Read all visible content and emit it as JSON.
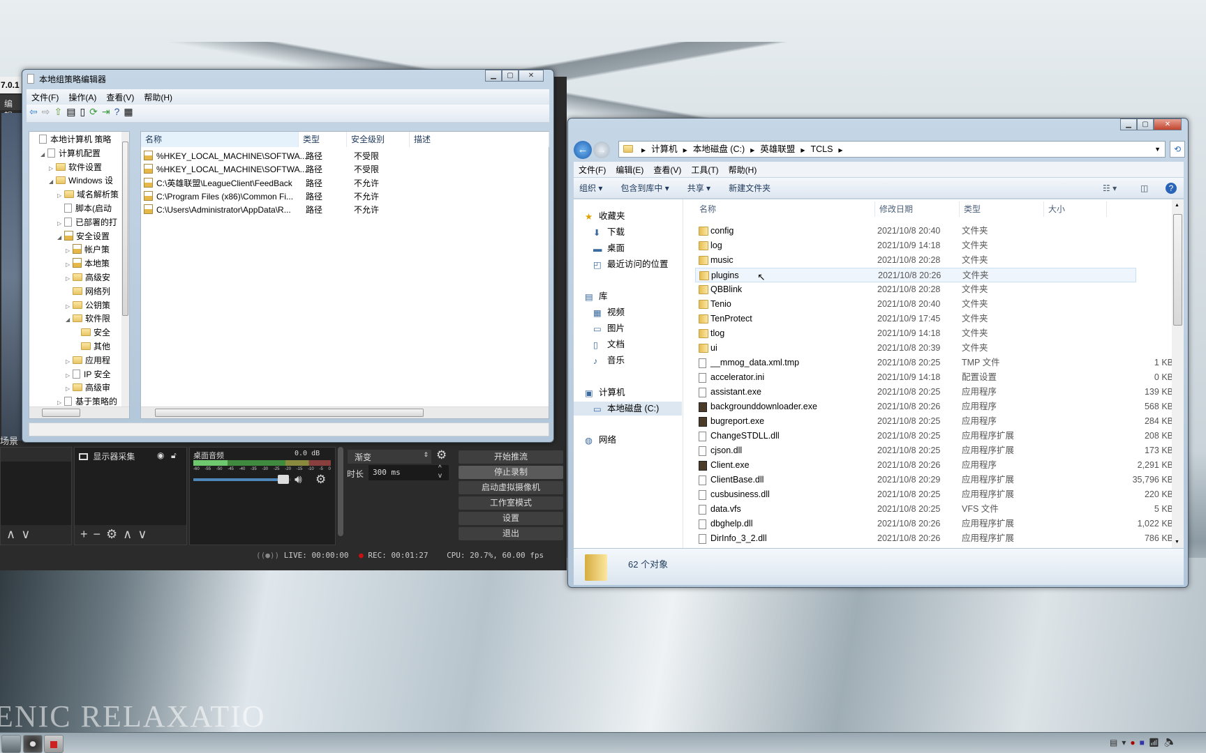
{
  "desktop": {
    "watermark": "ENIC RELAXATIO"
  },
  "obs": {
    "version_fragment": "7.0.1",
    "menu_fragment": "编辑",
    "scenes_label": "场景",
    "source_name": "显示器采集",
    "mixer": {
      "name": "桌面音频",
      "db": "0.0 dB",
      "scale": [
        "-60",
        "-55",
        "-50",
        "-45",
        "-40",
        "-35",
        "-30",
        "-25",
        "-20",
        "-15",
        "-10",
        "-5",
        "0"
      ],
      "volume": 0.95
    },
    "transition": {
      "type": "渐变",
      "duration_label": "时长",
      "duration": "300 ms"
    },
    "controls": [
      "开始推流",
      "停止录制",
      "启动虚拟摄像机",
      "工作室模式",
      "设置",
      "退出"
    ],
    "status": {
      "live": "LIVE: 00:00:00",
      "rec": "REC: 00:01:27",
      "cpu": "CPU: 20.7%, 60.00 fps"
    }
  },
  "gpedit": {
    "title": "本地组策略编辑器",
    "menu": [
      "文件(F)",
      "操作(A)",
      "查看(V)",
      "帮助(H)"
    ],
    "tree": [
      {
        "label": "本地计算机 策略",
        "level": 0,
        "icon": "policy"
      },
      {
        "label": "计算机配置",
        "level": 1,
        "icon": "computer",
        "exp": "open"
      },
      {
        "label": "软件设置",
        "level": 2,
        "icon": "folder",
        "exp": "closed"
      },
      {
        "label": "Windows 设",
        "level": 2,
        "icon": "folder",
        "exp": "open"
      },
      {
        "label": "域名解析策",
        "level": 3,
        "icon": "folder",
        "exp": "closed"
      },
      {
        "label": "脚本(启动",
        "level": 3,
        "icon": "script"
      },
      {
        "label": "已部署的打",
        "level": 3,
        "icon": "printer",
        "exp": "closed"
      },
      {
        "label": "安全设置",
        "level": 3,
        "icon": "security",
        "exp": "open"
      },
      {
        "label": "帐户策",
        "level": 4,
        "icon": "lock",
        "exp": "closed"
      },
      {
        "label": "本地策",
        "level": 4,
        "icon": "lock",
        "exp": "closed"
      },
      {
        "label": "高级安",
        "level": 4,
        "icon": "folder",
        "exp": "closed"
      },
      {
        "label": "网络列",
        "level": 4,
        "icon": "folder"
      },
      {
        "label": "公钥策",
        "level": 4,
        "icon": "folder",
        "exp": "closed"
      },
      {
        "label": "软件限",
        "level": 4,
        "icon": "folder",
        "exp": "open"
      },
      {
        "label": "安全",
        "level": 5,
        "icon": "folder"
      },
      {
        "label": "其他",
        "level": 5,
        "icon": "folder"
      },
      {
        "label": "应用程",
        "level": 4,
        "icon": "folder",
        "exp": "closed"
      },
      {
        "label": "IP 安全",
        "level": 4,
        "icon": "ipsec",
        "exp": "closed"
      },
      {
        "label": "高级审",
        "level": 4,
        "icon": "folder",
        "exp": "closed"
      },
      {
        "label": "基于策略的",
        "level": 3,
        "icon": "chart",
        "exp": "closed"
      }
    ],
    "columns": [
      "名称",
      "类型",
      "安全级别",
      "描述"
    ],
    "rows": [
      {
        "name": "%HKEY_LOCAL_MACHINE\\SOFTWA...",
        "type": "路径",
        "level": "不受限",
        "desc": ""
      },
      {
        "name": "%HKEY_LOCAL_MACHINE\\SOFTWA...",
        "type": "路径",
        "level": "不受限",
        "desc": ""
      },
      {
        "name": "C:\\英雄联盟\\LeagueClient\\FeedBack",
        "type": "路径",
        "level": "不允许",
        "desc": ""
      },
      {
        "name": "C:\\Program Files (x86)\\Common Fi...",
        "type": "路径",
        "level": "不允许",
        "desc": ""
      },
      {
        "name": "C:\\Users\\Administrator\\AppData\\R...",
        "type": "路径",
        "level": "不允许",
        "desc": ""
      }
    ]
  },
  "explorer": {
    "breadcrumb": [
      "计算机",
      "本地磁盘 (C:)",
      "英雄联盟",
      "TCLS"
    ],
    "menu": [
      "文件(F)",
      "编辑(E)",
      "查看(V)",
      "工具(T)",
      "帮助(H)"
    ],
    "commands": [
      "组织 ▾",
      "包含到库中 ▾",
      "共享 ▾",
      "新建文件夹"
    ],
    "nav": [
      {
        "label": "收藏夹",
        "level": 0,
        "icon": "star"
      },
      {
        "label": "下载",
        "level": 1,
        "icon": "download"
      },
      {
        "label": "桌面",
        "level": 1,
        "icon": "desktop"
      },
      {
        "label": "最近访问的位置",
        "level": 1,
        "icon": "recent"
      },
      {
        "label": "库",
        "level": 0,
        "icon": "library"
      },
      {
        "label": "视频",
        "level": 1,
        "icon": "video"
      },
      {
        "label": "图片",
        "level": 1,
        "icon": "picture"
      },
      {
        "label": "文档",
        "level": 1,
        "icon": "document"
      },
      {
        "label": "音乐",
        "level": 1,
        "icon": "music"
      },
      {
        "label": "计算机",
        "level": 0,
        "icon": "computer"
      },
      {
        "label": "本地磁盘 (C:)",
        "level": 1,
        "icon": "drive",
        "selected": true
      },
      {
        "label": "网络",
        "level": 0,
        "icon": "network"
      }
    ],
    "columns": [
      "名称",
      "修改日期",
      "类型",
      "大小"
    ],
    "hovered_row": "plugins",
    "files": [
      {
        "name": "config",
        "date": "2021/10/8 20:40",
        "type": "文件夹",
        "size": "",
        "icon": "folder"
      },
      {
        "name": "log",
        "date": "2021/10/9 14:18",
        "type": "文件夹",
        "size": "",
        "icon": "folder"
      },
      {
        "name": "music",
        "date": "2021/10/8 20:28",
        "type": "文件夹",
        "size": "",
        "icon": "folder"
      },
      {
        "name": "plugins",
        "date": "2021/10/8 20:26",
        "type": "文件夹",
        "size": "",
        "icon": "folder"
      },
      {
        "name": "QBBlink",
        "date": "2021/10/8 20:28",
        "type": "文件夹",
        "size": "",
        "icon": "folder"
      },
      {
        "name": "Tenio",
        "date": "2021/10/8 20:40",
        "type": "文件夹",
        "size": "",
        "icon": "folder"
      },
      {
        "name": "TenProtect",
        "date": "2021/10/9 17:45",
        "type": "文件夹",
        "size": "",
        "icon": "folder"
      },
      {
        "name": "tlog",
        "date": "2021/10/9 14:18",
        "type": "文件夹",
        "size": "",
        "icon": "folder"
      },
      {
        "name": "ui",
        "date": "2021/10/8 20:39",
        "type": "文件夹",
        "size": "",
        "icon": "folder"
      },
      {
        "name": "__mmog_data.xml.tmp",
        "date": "2021/10/8 20:25",
        "type": "TMP 文件",
        "size": "1 KB",
        "icon": "file"
      },
      {
        "name": "accelerator.ini",
        "date": "2021/10/9 14:18",
        "type": "配置设置",
        "size": "0 KB",
        "icon": "file"
      },
      {
        "name": "assistant.exe",
        "date": "2021/10/8 20:25",
        "type": "应用程序",
        "size": "139 KB",
        "icon": "app"
      },
      {
        "name": "backgrounddownloader.exe",
        "date": "2021/10/8 20:26",
        "type": "应用程序",
        "size": "568 KB",
        "icon": "exe"
      },
      {
        "name": "bugreport.exe",
        "date": "2021/10/8 20:25",
        "type": "应用程序",
        "size": "284 KB",
        "icon": "exe"
      },
      {
        "name": "ChangeSTDLL.dll",
        "date": "2021/10/8 20:25",
        "type": "应用程序扩展",
        "size": "208 KB",
        "icon": "file"
      },
      {
        "name": "cjson.dll",
        "date": "2021/10/8 20:25",
        "type": "应用程序扩展",
        "size": "173 KB",
        "icon": "file"
      },
      {
        "name": "Client.exe",
        "date": "2021/10/8 20:26",
        "type": "应用程序",
        "size": "2,291 KB",
        "icon": "exe"
      },
      {
        "name": "ClientBase.dll",
        "date": "2021/10/8 20:29",
        "type": "应用程序扩展",
        "size": "35,796 KB",
        "icon": "file"
      },
      {
        "name": "cusbusiness.dll",
        "date": "2021/10/8 20:25",
        "type": "应用程序扩展",
        "size": "220 KB",
        "icon": "file"
      },
      {
        "name": "data.vfs",
        "date": "2021/10/8 20:25",
        "type": "VFS 文件",
        "size": "5 KB",
        "icon": "file"
      },
      {
        "name": "dbghelp.dll",
        "date": "2021/10/8 20:26",
        "type": "应用程序扩展",
        "size": "1,022 KB",
        "icon": "file"
      },
      {
        "name": "DirInfo_3_2.dll",
        "date": "2021/10/8 20:26",
        "type": "应用程序扩展",
        "size": "786 KB",
        "icon": "file"
      }
    ],
    "status": "62 个对象"
  }
}
